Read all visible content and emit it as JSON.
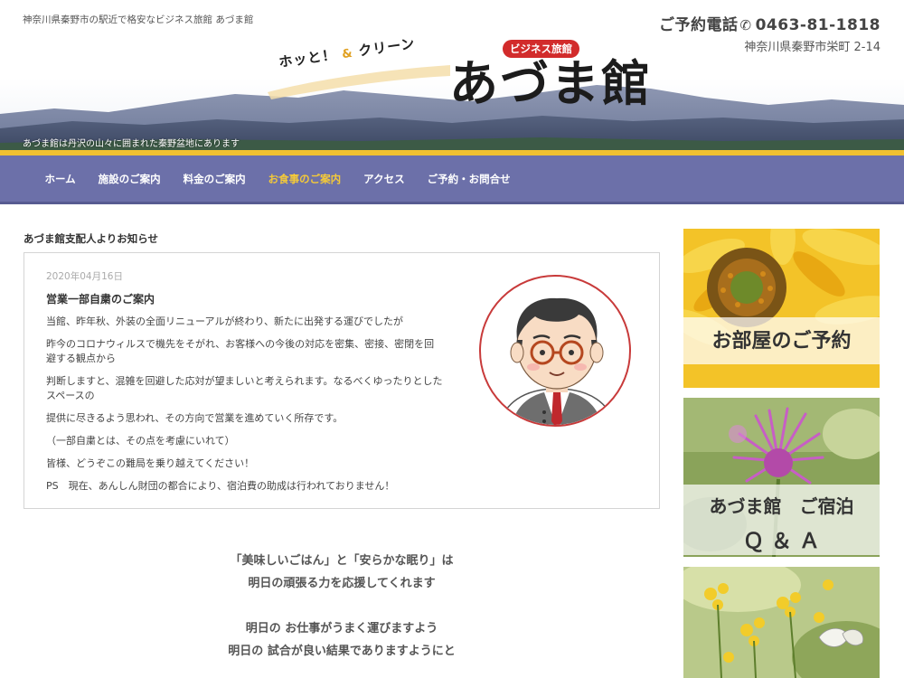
{
  "header": {
    "tagline": "神奈川県秦野市の駅近で格安なビジネス旅館 あづま館",
    "phone_label": "ご予約電話",
    "phone_number": "0463-81-1818",
    "address": "神奈川県秦野市栄町 2-14",
    "logo_sub_part1": "ホッと！",
    "logo_amp": "&",
    "logo_sub_part2": "クリーン",
    "logo_badge": "ビジネス旅館",
    "logo_main": "あづま館",
    "hero_caption": "あづま館は丹沢の山々に囲まれた秦野盆地にあります"
  },
  "nav": {
    "items": [
      {
        "label": "ホーム"
      },
      {
        "label": "施設のご案内"
      },
      {
        "label": "料金のご案内"
      },
      {
        "label": "お食事のご案内"
      },
      {
        "label": "アクセス"
      },
      {
        "label": "ご予約・お問合せ"
      }
    ],
    "active_index": 3
  },
  "notice": {
    "heading": "あづま館支配人よりお知らせ",
    "date": "2020年04月16日",
    "title": "営業一部自粛のご案内",
    "paragraphs": [
      "当館、昨年秋、外装の全面リニューアルが終わり、新たに出発する運びでしたが",
      "昨今のコロナウィルスで機先をそがれ、お客様への今後の対応を密集、密接、密閉を回避する観点から",
      "判断しますと、混雑を回避した応対が望ましいと考えられます。なるべくゆったりとしたスペースの",
      "提供に尽きるよう思われ、その方向で営業を進めていく所存です。",
      "（一部自粛とは、その点を考慮にいれて）",
      "皆様、どうぞこの難局を乗り越えてください！",
      "PS　現在、あんしん財団の都合により、宿泊費の助成は行われておりません！"
    ]
  },
  "closing": {
    "line1": "「美味しいごはん」と「安らかな眠り」は",
    "line2": "明日の頑張る力を応援してくれます",
    "line3": "明日の お仕事がうまく運びますよう",
    "line4": "明日の 試合が良い結果でありますようにと"
  },
  "sidebar": {
    "banner1": "お部屋のご予約",
    "banner2_line1": "あづま館　ご宿泊",
    "banner2_line2": "Ｑ ＆ Ａ"
  },
  "colors": {
    "nav_bg": "#6c70a9",
    "nav_active": "#f3c93a",
    "nav_top_stripe": "#f0c030",
    "badge_red": "#d22b2b"
  }
}
